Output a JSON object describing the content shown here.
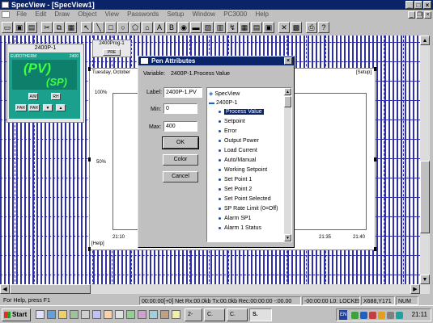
{
  "window": {
    "title": "SpecView - [SpecView1]"
  },
  "menu": {
    "items": [
      "File",
      "Edit",
      "Draw",
      "Object",
      "View",
      "Passwords",
      "Setup",
      "Window",
      "PC3000",
      "Help"
    ]
  },
  "toolbar": {
    "icons": [
      "new-icon",
      "open-icon",
      "save-icon",
      "cut-icon",
      "copy-icon",
      "paste-icon",
      "delete-icon",
      "pointer-icon",
      "line-icon",
      "rectangle-icon",
      "rounded-rect-icon",
      "ellipse-icon",
      "polygon-icon",
      "text-icon",
      "button-icon",
      "dial-icon",
      "image-icon",
      "barchart-icon",
      "trend-icon",
      "grid-icon",
      "meter-icon",
      "record-icon",
      "tools-icon",
      "alarm-icon",
      "print-icon",
      "help-icon"
    ]
  },
  "controller": {
    "title": "2400P-1",
    "brand": "EUROTHERM",
    "model": "2400",
    "pv": "(PV)",
    "sp": "(SP)",
    "btn_am": "A/M",
    "btn_rh": "RH",
    "btn_par": "PAR",
    "btn_par2": "PAR"
  },
  "program_widget": {
    "title": "2400Prog-1",
    "button": "PRE"
  },
  "trend": {
    "header_left": "Tuesday, October",
    "header_right": "[Setup]",
    "y100": "100%",
    "y50": "50%",
    "y0": "0%",
    "x_labels": [
      "21:10",
      "21:35",
      "21:40"
    ],
    "footer_left": "[Help]"
  },
  "dialog": {
    "title": "Pen Attributes",
    "variable_label": "Variable:",
    "variable_value": "2400P-1.Process Value",
    "label_label": "Label:",
    "label_value": "2400P-1.PV",
    "min_label": "Min:",
    "min_value": "0",
    "max_label": "Max:",
    "max_value": "400",
    "ok": "OK",
    "color": "Color",
    "cancel": "Cancel",
    "tree_root": "SpecView",
    "tree_device": "2400P-1",
    "tree_items": [
      "Process Value",
      "Setpoint",
      "Error",
      "Output Power",
      "Load Current",
      "Auto/Manual",
      "Working Setpoint",
      "Set Point 1",
      "Set Point 2",
      "Set Point Selected",
      "SP Rate Limit (0=Off)",
      "Alarm SP1",
      "Alarm 1 Status"
    ]
  },
  "statusbar": {
    "help": "For Help, press F1",
    "stats": "00:00:00[+0] Net Rx:00.0kb Tx:00.0kb Rec:00:00:00 -:00.00",
    "lock": "-00:00:00 L0: LOCKED",
    "coords": "X688,Y171",
    "num": "NUM"
  },
  "taskbar": {
    "start": "Start",
    "tasks": [
      "2-",
      "C.",
      "C.",
      "S."
    ],
    "clock": "21:11",
    "lang": "EN"
  }
}
